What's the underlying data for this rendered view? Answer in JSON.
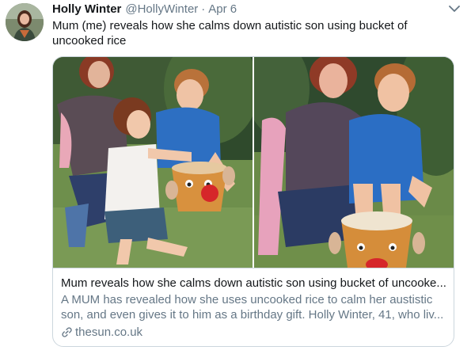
{
  "author": {
    "name": "Holly Winter",
    "handle": "@HollyWinter",
    "separator": "·",
    "date": "Apr 6"
  },
  "tweet": {
    "text": "Mum (me) reveals how she calms down autistic son using bucket of uncooked rice"
  },
  "card": {
    "title": "Mum reveals how she calms down autistic son using bucket of uncooke...",
    "description": "A MUM has revealed how she uses uncooked rice to calm her austistic son, and even gives it to him as a birthday gift. Holly Winter, 41, who liv...",
    "domain": "thesun.co.uk"
  },
  "icons": {
    "caret": "chevron-down-icon",
    "link": "link-icon"
  },
  "colors": {
    "text_primary": "#14171a",
    "text_secondary": "#657786",
    "border": "#ccd6dd"
  }
}
